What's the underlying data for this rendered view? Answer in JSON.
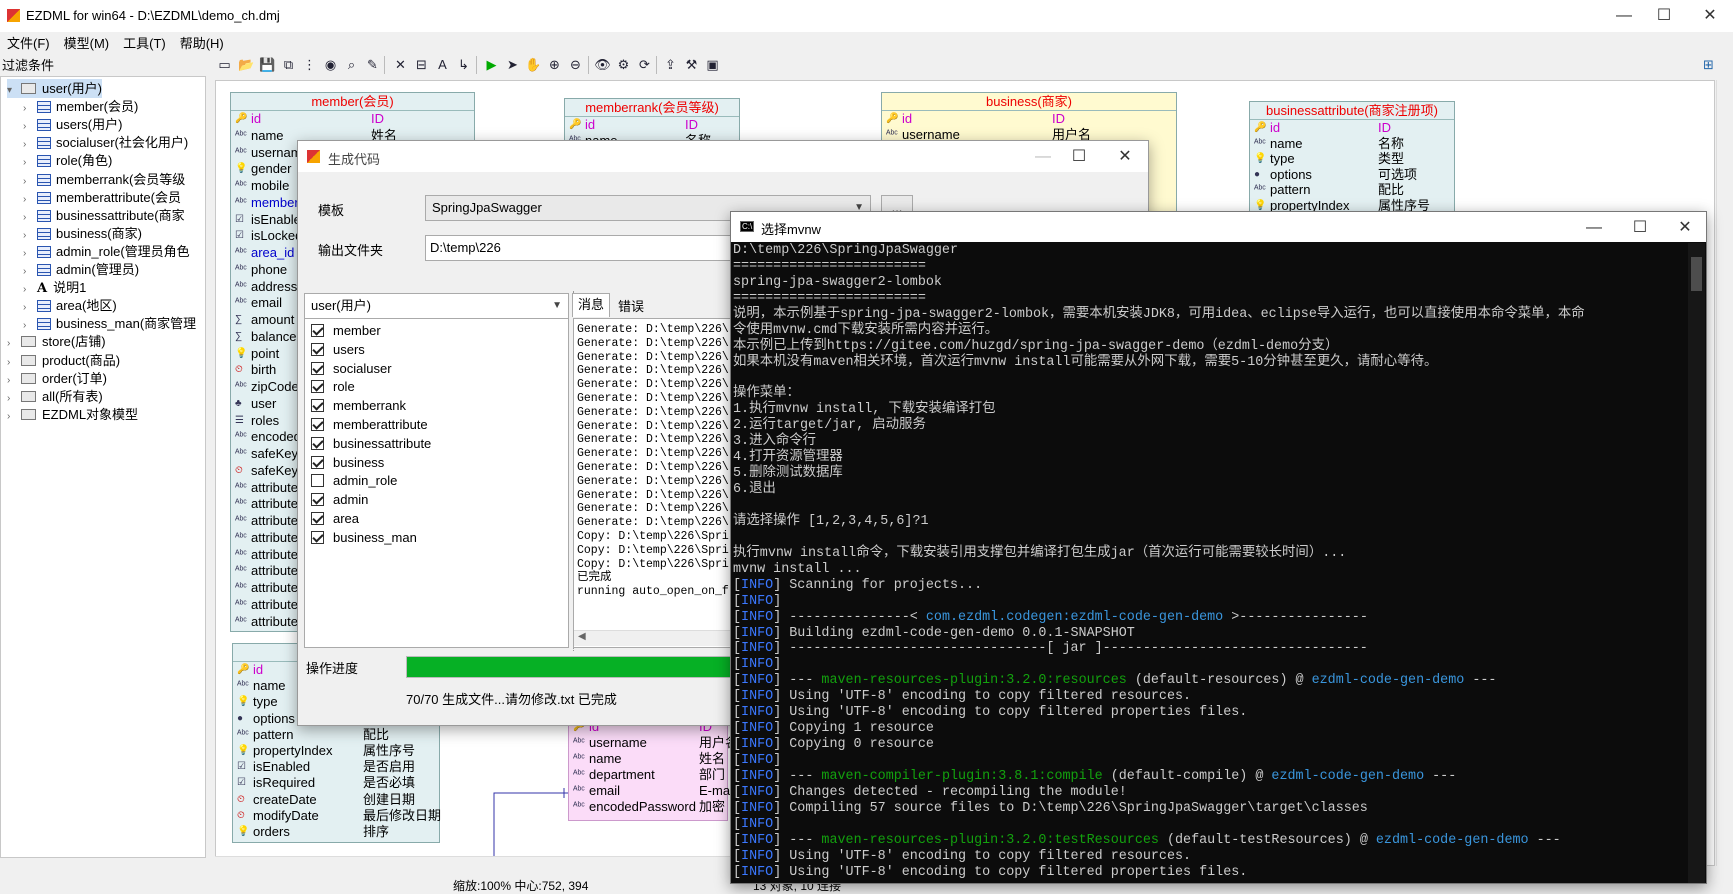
{
  "app": {
    "title": "EZDML for win64 - D:\\EZDML\\demo_ch.dmj",
    "controls": [
      "—",
      "☐",
      "✕"
    ]
  },
  "menu": [
    "文件(F)",
    "模型(M)",
    "工具(T)",
    "帮助(H)"
  ],
  "left_panel": {
    "filter_label": "过滤条件",
    "tree": [
      {
        "label": "user(用户)",
        "kind": "folder",
        "level": 0,
        "expanded": true,
        "selected": true
      },
      {
        "label": "member(会员)",
        "kind": "table",
        "level": 1
      },
      {
        "label": "users(用户)",
        "kind": "table",
        "level": 1
      },
      {
        "label": "socialuser(社会化用户)",
        "kind": "table",
        "level": 1
      },
      {
        "label": "role(角色)",
        "kind": "table",
        "level": 1
      },
      {
        "label": "memberrank(会员等级",
        "kind": "table",
        "level": 1
      },
      {
        "label": "memberattribute(会员",
        "kind": "table",
        "level": 1
      },
      {
        "label": "businessattribute(商家",
        "kind": "table",
        "level": 1
      },
      {
        "label": "business(商家)",
        "kind": "table",
        "level": 1
      },
      {
        "label": "admin_role(管理员角色",
        "kind": "table",
        "level": 1
      },
      {
        "label": "admin(管理员)",
        "kind": "table",
        "level": 1
      },
      {
        "label": "说明1",
        "kind": "text",
        "level": 1
      },
      {
        "label": "area(地区)",
        "kind": "table",
        "level": 1
      },
      {
        "label": "business_man(商家管理",
        "kind": "table",
        "level": 1
      },
      {
        "label": "store(店铺)",
        "kind": "folder",
        "level": 0
      },
      {
        "label": "product(商品)",
        "kind": "folder",
        "level": 0
      },
      {
        "label": "order(订单)",
        "kind": "folder",
        "level": 0
      },
      {
        "label": "all(所有表)",
        "kind": "folder",
        "level": 0
      },
      {
        "label": "EZDML对象模型",
        "kind": "folder",
        "level": 0
      }
    ]
  },
  "diagram": {
    "member": {
      "title": "member(会员)",
      "fields": [
        {
          "name": "id",
          "comment": "ID",
          "icon": "key"
        },
        {
          "name": "name",
          "comment": "姓名",
          "icon": "abc"
        },
        {
          "name": "usernam",
          "comment": "",
          "icon": "abc"
        },
        {
          "name": "gender",
          "comment": "",
          "icon": "bulb"
        },
        {
          "name": "mobile",
          "comment": "",
          "icon": "abc"
        },
        {
          "name": "member",
          "comment": "",
          "icon": "abc",
          "fk": true
        },
        {
          "name": "isEnable",
          "comment": "",
          "icon": "bool"
        },
        {
          "name": "isLocked",
          "comment": "",
          "icon": "bool"
        },
        {
          "name": "area_id",
          "comment": "",
          "icon": "abc",
          "fk": true
        },
        {
          "name": "phone",
          "comment": "",
          "icon": "abc"
        },
        {
          "name": "address",
          "comment": "",
          "icon": "abc"
        },
        {
          "name": "email",
          "comment": "",
          "icon": "abc"
        },
        {
          "name": "amount",
          "comment": "",
          "icon": "num"
        },
        {
          "name": "balance",
          "comment": "",
          "icon": "num"
        },
        {
          "name": "point",
          "comment": "",
          "icon": "bulb"
        },
        {
          "name": "birth",
          "comment": "",
          "icon": "clock"
        },
        {
          "name": "zipCode",
          "comment": "",
          "icon": "abc"
        },
        {
          "name": "user",
          "comment": "",
          "icon": "obj"
        },
        {
          "name": "roles",
          "comment": "",
          "icon": "list"
        },
        {
          "name": "encoded",
          "comment": "",
          "icon": "abc"
        },
        {
          "name": "safeKeyV",
          "comment": "",
          "icon": "abc"
        },
        {
          "name": "safeKeyE",
          "comment": "",
          "icon": "clock"
        },
        {
          "name": "attribute",
          "comment": "",
          "icon": "abc"
        },
        {
          "name": "attribute",
          "comment": "",
          "icon": "abc"
        },
        {
          "name": "attribute",
          "comment": "",
          "icon": "abc"
        },
        {
          "name": "attribute",
          "comment": "",
          "icon": "abc"
        },
        {
          "name": "attribute",
          "comment": "",
          "icon": "abc"
        },
        {
          "name": "attribute",
          "comment": "",
          "icon": "abc"
        },
        {
          "name": "attribute",
          "comment": "",
          "icon": "abc"
        },
        {
          "name": "attribute",
          "comment": "",
          "icon": "abc"
        },
        {
          "name": "attribute",
          "comment": "",
          "icon": "abc"
        }
      ]
    },
    "memberrank": {
      "title": "memberrank(会员等级)",
      "fields": [
        {
          "name": "id",
          "comment": "ID",
          "icon": "key"
        },
        {
          "name": "name",
          "comment": "名称",
          "icon": "abc"
        }
      ]
    },
    "business": {
      "title": "business(商家)",
      "fields": [
        {
          "name": "id",
          "comment": "ID",
          "icon": "key"
        },
        {
          "name": "username",
          "comment": "用户名",
          "icon": "abc"
        }
      ]
    },
    "businessattribute": {
      "title": "businessattribute(商家注册项)",
      "fields": [
        {
          "name": "id",
          "comment": "ID",
          "icon": "key"
        },
        {
          "name": "name",
          "comment": "名称",
          "icon": "abc"
        },
        {
          "name": "type",
          "comment": "类型",
          "icon": "bulb"
        },
        {
          "name": "options",
          "comment": "可选项",
          "icon": "dot"
        },
        {
          "name": "pattern",
          "comment": "配比",
          "icon": "abc"
        },
        {
          "name": "propertyIndex",
          "comment": "属性序号",
          "icon": "bulb"
        }
      ]
    },
    "memberattribute": {
      "title": "member",
      "fields": [
        {
          "name": "id",
          "comment": "",
          "icon": "key"
        },
        {
          "name": "name",
          "comment": "",
          "icon": "abc"
        },
        {
          "name": "type",
          "comment": "",
          "icon": "bulb"
        },
        {
          "name": "options",
          "comment": "可选项",
          "icon": "dot"
        },
        {
          "name": "pattern",
          "comment": "配比",
          "icon": "abc"
        },
        {
          "name": "propertyIndex",
          "comment": "属性序号",
          "icon": "bulb"
        },
        {
          "name": "isEnabled",
          "comment": "是否启用",
          "icon": "bool"
        },
        {
          "name": "isRequired",
          "comment": "是否必填",
          "icon": "bool"
        },
        {
          "name": "createDate",
          "comment": "创建日期",
          "icon": "clock"
        },
        {
          "name": "modifyDate",
          "comment": "最后修改日期",
          "icon": "clock"
        },
        {
          "name": "orders",
          "comment": "排序",
          "icon": "bulb"
        }
      ]
    },
    "admin": {
      "fields": [
        {
          "name": "id",
          "comment": "ID",
          "icon": "key"
        },
        {
          "name": "username",
          "comment": "用户名",
          "icon": "abc"
        },
        {
          "name": "name",
          "comment": "姓名",
          "icon": "abc"
        },
        {
          "name": "department",
          "comment": "部门",
          "icon": "abc"
        },
        {
          "name": "email",
          "comment": "E-ma",
          "icon": "abc"
        },
        {
          "name": "encodedPassword",
          "comment": "加密",
          "icon": "abc"
        }
      ]
    }
  },
  "status": {
    "zoom_center": "缩放:100% 中心:752, 394",
    "objects": "13 对象, 10 连接"
  },
  "gen_dialog": {
    "title": "生成代码",
    "template_label": "模板",
    "template_value": "SpringJpaSwagger",
    "template_button": "...",
    "outdir_label": "输出文件夹",
    "outdir_value": "D:\\temp\\226",
    "group_value": "user(用户)",
    "tables": [
      {
        "name": "member",
        "checked": true
      },
      {
        "name": "users",
        "checked": true
      },
      {
        "name": "socialuser",
        "checked": true
      },
      {
        "name": "role",
        "checked": true
      },
      {
        "name": "memberrank",
        "checked": true
      },
      {
        "name": "memberattribute",
        "checked": true
      },
      {
        "name": "businessattribute",
        "checked": true
      },
      {
        "name": "business",
        "checked": true
      },
      {
        "name": "admin_role",
        "checked": false
      },
      {
        "name": "admin",
        "checked": true
      },
      {
        "name": "area",
        "checked": true
      },
      {
        "name": "business_man",
        "checked": true
      }
    ],
    "tabs": [
      "消息",
      "错误"
    ],
    "log": [
      "Generate: D:\\temp\\226\\",
      "Generate: D:\\temp\\226\\",
      "Generate: D:\\temp\\226\\",
      "Generate: D:\\temp\\226\\",
      "Generate: D:\\temp\\226\\",
      "Generate: D:\\temp\\226\\",
      "Generate: D:\\temp\\226\\",
      "Generate: D:\\temp\\226\\",
      "Generate: D:\\temp\\226\\",
      "Generate: D:\\temp\\226\\",
      "Generate: D:\\temp\\226\\",
      "Generate: D:\\temp\\226\\",
      "Generate: D:\\temp\\226\\",
      "Generate: D:\\temp\\226\\",
      "Generate: D:\\temp\\226\\",
      "Copy: D:\\temp\\226\\Spri",
      "Copy: D:\\temp\\226\\Spri",
      "Copy: D:\\temp\\226\\Spri",
      "已完成",
      "running auto_open_on_f"
    ],
    "progress_label": "操作进度",
    "progress": 1.0,
    "progress_text": "70/70 生成文件...请勿修改.txt 已完成"
  },
  "console": {
    "title": "选择mvnw",
    "lines": [
      [
        {
          "t": "D:\\temp\\226\\SpringJpaSwagger",
          "c": ""
        }
      ],
      [
        {
          "t": "========================",
          "c": ""
        }
      ],
      [
        {
          "t": "spring-jpa-swagger2-lombok",
          "c": ""
        }
      ],
      [
        {
          "t": "========================",
          "c": ""
        }
      ],
      [
        {
          "t": "说明，本示例基于spring-jpa-swagger2-lombok，需要本机安装JDK8，可用idea、eclipse导入运行，也可以直接使用本命令菜单，本命",
          "c": ""
        }
      ],
      [
        {
          "t": "令使用mvnw.cmd下载安装所需内容并运行。",
          "c": ""
        }
      ],
      [
        {
          "t": "本示例已上传到https://gitee.com/huzgd/spring-jpa-swagger-demo（ezdml-demo分支）",
          "c": ""
        }
      ],
      [
        {
          "t": "如果本机没有maven相关环境，首次运行mvnw install可能需要从外网下载，需要5-10分钟甚至更久，请耐心等待。",
          "c": ""
        }
      ],
      [
        {
          "t": "",
          "c": ""
        }
      ],
      [
        {
          "t": "操作菜单：",
          "c": ""
        }
      ],
      [
        {
          "t": "1.执行mvnw install, 下载安装编译打包",
          "c": ""
        }
      ],
      [
        {
          "t": "2.运行target/jar, 启动服务",
          "c": ""
        }
      ],
      [
        {
          "t": "3.进入命令行",
          "c": ""
        }
      ],
      [
        {
          "t": "4.打开资源管理器",
          "c": ""
        }
      ],
      [
        {
          "t": "5.删除测试数据库",
          "c": ""
        }
      ],
      [
        {
          "t": "6.退出",
          "c": ""
        }
      ],
      [
        {
          "t": "",
          "c": ""
        }
      ],
      [
        {
          "t": "请选择操作 [1,2,3,4,5,6]?1",
          "c": ""
        }
      ],
      [
        {
          "t": "",
          "c": ""
        }
      ],
      [
        {
          "t": "执行mvnw install命令，下载安装引用支撑包并编译打包生成jar（首次运行可能需要较长时间）...",
          "c": ""
        }
      ],
      [
        {
          "t": "mvnw install ...",
          "c": ""
        }
      ],
      [
        {
          "t": "[",
          "c": ""
        },
        {
          "t": "INFO",
          "c": "cb"
        },
        {
          "t": "] Scanning for projects...",
          "c": ""
        }
      ],
      [
        {
          "t": "[",
          "c": ""
        },
        {
          "t": "INFO",
          "c": "cb"
        },
        {
          "t": "]",
          "c": ""
        }
      ],
      [
        {
          "t": "[",
          "c": ""
        },
        {
          "t": "INFO",
          "c": "cb"
        },
        {
          "t": "] ---------------< ",
          "c": ""
        },
        {
          "t": "com.ezdml.codegen:ezdml-code-gen-demo",
          "c": "cc"
        },
        {
          "t": " >----------------",
          "c": ""
        }
      ],
      [
        {
          "t": "[",
          "c": ""
        },
        {
          "t": "INFO",
          "c": "cb"
        },
        {
          "t": "] Building ezdml-code-gen-demo 0.0.1-SNAPSHOT",
          "c": ""
        }
      ],
      [
        {
          "t": "[",
          "c": ""
        },
        {
          "t": "INFO",
          "c": "cb"
        },
        {
          "t": "] --------------------------------[ jar ]---------------------------------",
          "c": ""
        }
      ],
      [
        {
          "t": "[",
          "c": ""
        },
        {
          "t": "INFO",
          "c": "cb"
        },
        {
          "t": "]",
          "c": ""
        }
      ],
      [
        {
          "t": "[",
          "c": ""
        },
        {
          "t": "INFO",
          "c": "cb"
        },
        {
          "t": "] --- ",
          "c": ""
        },
        {
          "t": "maven-resources-plugin:3.2.0:resources",
          "c": "cg"
        },
        {
          "t": " (default-resources) @ ",
          "c": ""
        },
        {
          "t": "ezdml-code-gen-demo",
          "c": "cc"
        },
        {
          "t": " ---",
          "c": ""
        }
      ],
      [
        {
          "t": "[",
          "c": ""
        },
        {
          "t": "INFO",
          "c": "cb"
        },
        {
          "t": "] Using 'UTF-8' encoding to copy filtered resources.",
          "c": ""
        }
      ],
      [
        {
          "t": "[",
          "c": ""
        },
        {
          "t": "INFO",
          "c": "cb"
        },
        {
          "t": "] Using 'UTF-8' encoding to copy filtered properties files.",
          "c": ""
        }
      ],
      [
        {
          "t": "[",
          "c": ""
        },
        {
          "t": "INFO",
          "c": "cb"
        },
        {
          "t": "] Copying 1 resource",
          "c": ""
        }
      ],
      [
        {
          "t": "[",
          "c": ""
        },
        {
          "t": "INFO",
          "c": "cb"
        },
        {
          "t": "] Copying 0 resource",
          "c": ""
        }
      ],
      [
        {
          "t": "[",
          "c": ""
        },
        {
          "t": "INFO",
          "c": "cb"
        },
        {
          "t": "]",
          "c": ""
        }
      ],
      [
        {
          "t": "[",
          "c": ""
        },
        {
          "t": "INFO",
          "c": "cb"
        },
        {
          "t": "] --- ",
          "c": ""
        },
        {
          "t": "maven-compiler-plugin:3.8.1:compile",
          "c": "cg"
        },
        {
          "t": " (default-compile) @ ",
          "c": ""
        },
        {
          "t": "ezdml-code-gen-demo",
          "c": "cc"
        },
        {
          "t": " ---",
          "c": ""
        }
      ],
      [
        {
          "t": "[",
          "c": ""
        },
        {
          "t": "INFO",
          "c": "cb"
        },
        {
          "t": "] Changes detected - recompiling the module!",
          "c": ""
        }
      ],
      [
        {
          "t": "[",
          "c": ""
        },
        {
          "t": "INFO",
          "c": "cb"
        },
        {
          "t": "] Compiling 57 source files to D:\\temp\\226\\SpringJpaSwagger\\target\\classes",
          "c": ""
        }
      ],
      [
        {
          "t": "[",
          "c": ""
        },
        {
          "t": "INFO",
          "c": "cb"
        },
        {
          "t": "]",
          "c": ""
        }
      ],
      [
        {
          "t": "[",
          "c": ""
        },
        {
          "t": "INFO",
          "c": "cb"
        },
        {
          "t": "] --- ",
          "c": ""
        },
        {
          "t": "maven-resources-plugin:3.2.0:testResources",
          "c": "cg"
        },
        {
          "t": " (default-testResources) @ ",
          "c": ""
        },
        {
          "t": "ezdml-code-gen-demo",
          "c": "cc"
        },
        {
          "t": " ---",
          "c": ""
        }
      ],
      [
        {
          "t": "[",
          "c": ""
        },
        {
          "t": "INFO",
          "c": "cb"
        },
        {
          "t": "] Using 'UTF-8' encoding to copy filtered resources.",
          "c": ""
        }
      ],
      [
        {
          "t": "[",
          "c": ""
        },
        {
          "t": "INFO",
          "c": "cb"
        },
        {
          "t": "] Using 'UTF-8' encoding to copy filtered properties files.",
          "c": ""
        }
      ]
    ]
  }
}
